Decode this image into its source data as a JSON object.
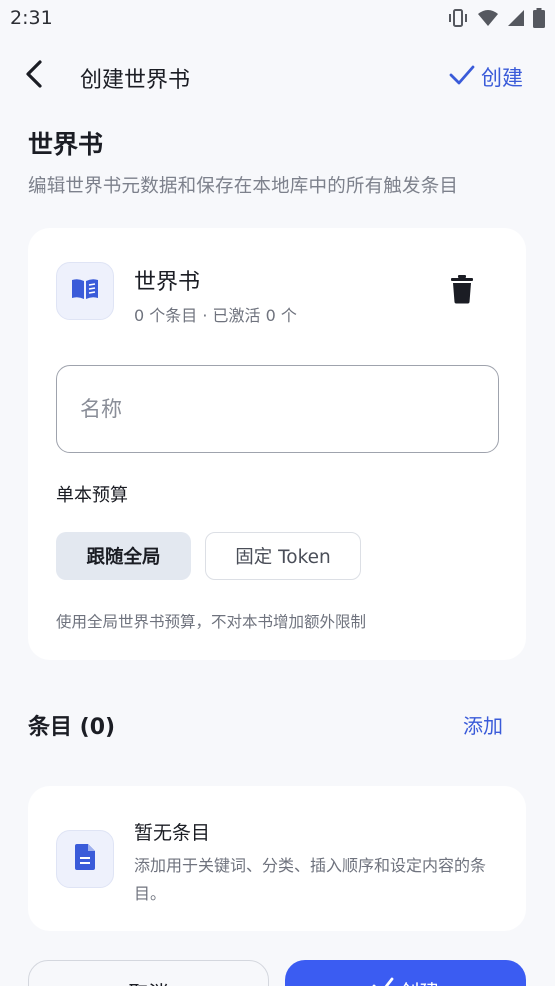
{
  "status_bar": {
    "time": "2:31",
    "icons": [
      "vibrate-icon",
      "wifi-icon",
      "signal-icon",
      "battery-icon"
    ]
  },
  "app_bar": {
    "title": "创建世界书",
    "create_label": "创建"
  },
  "header": {
    "title": "世界书",
    "subtitle": "编辑世界书元数据和保存在本地库中的所有触发条目"
  },
  "book_card": {
    "name": "世界书",
    "meta": "0 个条目 · 已激活 0 个",
    "name_input": {
      "placeholder": "名称",
      "value": ""
    },
    "budget_label": "单本预算",
    "budget_options": [
      "跟随全局",
      "固定 Token"
    ],
    "budget_selected": "跟随全局",
    "budget_hint": "使用全局世界书预算，不对本书增加额外限制"
  },
  "entries": {
    "title": "条目 (0)",
    "add_label": "添加",
    "empty_title": "暂无条目",
    "empty_desc": "添加用于关键词、分类、插入顺序和设定内容的条目。"
  },
  "footer": {
    "cancel_label": "取消",
    "create_label": "创建"
  },
  "colors": {
    "accent": "#3a5bd9",
    "primary_button": "#3b5cf2",
    "background": "#f7f8fb",
    "card": "#ffffff"
  }
}
